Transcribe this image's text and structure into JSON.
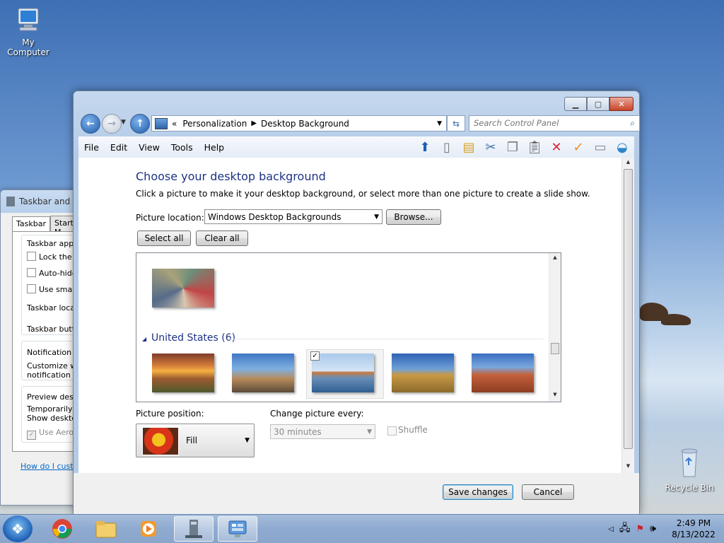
{
  "desktop": {
    "icons": [
      {
        "label": "My Computer"
      },
      {
        "label": "Recycle Bin"
      }
    ]
  },
  "back_window": {
    "title": "Taskbar and S",
    "tabs": [
      "Taskbar",
      "Start M"
    ],
    "lines": {
      "appearance": "Taskbar appea",
      "lock": "Lock the ta",
      "autohide": "Auto-hide",
      "small": "Use small i",
      "location": "Taskbar locati",
      "buttons": "Taskbar butto",
      "notification": "Notification ar",
      "customize1": "Customize wh",
      "customize2": "notification ar",
      "preview": "Preview deskt",
      "temp": "Temporarily vi",
      "show": "Show desktop",
      "aero": "Use Aero P"
    },
    "help_link": "How do I custor"
  },
  "window": {
    "address": {
      "prefix": "«",
      "crumbs": [
        "Personalization",
        "Desktop Background"
      ]
    },
    "search": {
      "placeholder": "Search Control Panel"
    },
    "menu": [
      "File",
      "Edit",
      "View",
      "Tools",
      "Help"
    ],
    "content": {
      "heading": "Choose your desktop background",
      "subtext": "Click a picture to make it your desktop background, or select more than one picture to create a slide show.",
      "picture_location_label": "Picture location:",
      "picture_location_value": "Windows Desktop Backgrounds",
      "browse_label": "Browse...",
      "select_all_label": "Select all",
      "clear_all_label": "Clear all",
      "group_header": "United States (6)",
      "picture_position_label": "Picture position:",
      "picture_position_value": "Fill",
      "change_every_label": "Change picture every:",
      "change_every_value": "30 minutes",
      "shuffle_label": "Shuffle"
    },
    "footer": {
      "save_label": "Save changes",
      "cancel_label": "Cancel"
    }
  },
  "taskbar": {
    "time": "2:49 PM",
    "date": "8/13/2022"
  }
}
